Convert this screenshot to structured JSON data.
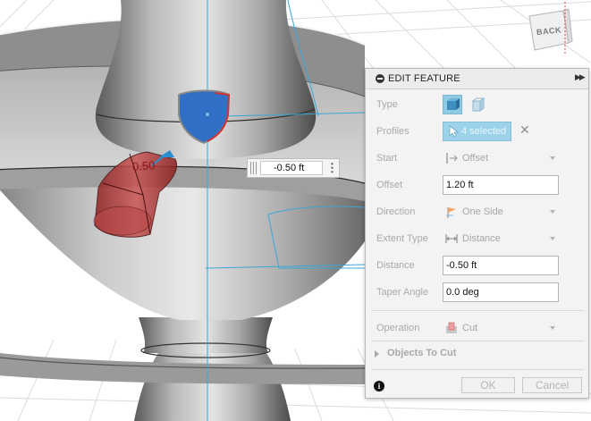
{
  "viewcube": {
    "label": "BACK"
  },
  "canvas": {
    "dimension_label": "0.50",
    "input_value": "-0.50 ft",
    "input_menu_glyph": "⋮"
  },
  "panel": {
    "title": "EDIT FEATURE",
    "expand_glyph": "▶▶",
    "rows": {
      "type": {
        "label": "Type",
        "icons": [
          "solid-extrude-icon",
          "surface-extrude-icon"
        ]
      },
      "profiles": {
        "label": "Profiles",
        "value": "4 selected",
        "clear_glyph": "✕",
        "icon": "cursor-select-icon"
      },
      "start": {
        "label": "Start",
        "value": "Offset",
        "icon": "offset-start-icon"
      },
      "offset": {
        "label": "Offset",
        "value": "1.20 ft"
      },
      "direction": {
        "label": "Direction",
        "value": "One Side",
        "icon": "one-side-flag-icon"
      },
      "extent_type": {
        "label": "Extent Type",
        "value": "Distance",
        "icon": "distance-extent-icon"
      },
      "distance": {
        "label": "Distance",
        "value": "-0.50 ft"
      },
      "taper_angle": {
        "label": "Taper Angle",
        "value": "0.0 deg"
      },
      "operation": {
        "label": "Operation",
        "value": "Cut",
        "icon": "cut-operation-icon"
      }
    },
    "objects_to_cut": {
      "label": "Objects To Cut"
    },
    "footer": {
      "info_glyph": "i",
      "ok_label": "OK",
      "cancel_label": "Cancel"
    }
  },
  "colors": {
    "selection_blue": "#2f6fc4",
    "cut_red": "#b23a3a",
    "highlight_cyan": "#3aa6d6",
    "chip_blue": "#9dd3ea",
    "grid_line": "#d6d6d6"
  }
}
